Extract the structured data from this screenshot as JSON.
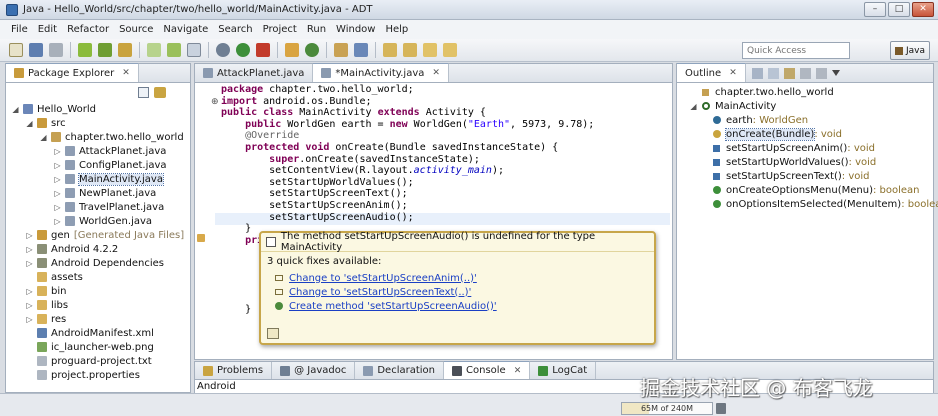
{
  "window": {
    "title": "Java - Hello_World/src/chapter/two/hello_world/MainActivity.java - ADT"
  },
  "menu": [
    "File",
    "Edit",
    "Refactor",
    "Source",
    "Navigate",
    "Search",
    "Project",
    "Run",
    "Window",
    "Help"
  ],
  "toolbar": {
    "quick_access_placeholder": "Quick Access",
    "perspective": "Java"
  },
  "package_explorer": {
    "tab": "Package Explorer",
    "tree": [
      {
        "label": "Hello_World",
        "depth": 0,
        "twisty": "open",
        "icon": "project-icon"
      },
      {
        "label": "src",
        "depth": 1,
        "twisty": "open",
        "icon": "source-folder-icon"
      },
      {
        "label": "chapter.two.hello_world",
        "depth": 2,
        "twisty": "open",
        "icon": "package-icon"
      },
      {
        "label": "AttackPlanet.java",
        "depth": 3,
        "twisty": "closed",
        "icon": "java-file-icon"
      },
      {
        "label": "ConfigPlanet.java",
        "depth": 3,
        "twisty": "closed",
        "icon": "java-file-icon"
      },
      {
        "label": "MainActivity.java",
        "depth": 3,
        "twisty": "closed",
        "icon": "java-file-icon",
        "selected": true
      },
      {
        "label": "NewPlanet.java",
        "depth": 3,
        "twisty": "closed",
        "icon": "java-file-icon"
      },
      {
        "label": "TravelPlanet.java",
        "depth": 3,
        "twisty": "closed",
        "icon": "java-file-icon"
      },
      {
        "label": "WorldGen.java",
        "depth": 3,
        "twisty": "closed",
        "icon": "java-file-icon"
      },
      {
        "label": "gen",
        "suffix": "[Generated Java Files]",
        "depth": 1,
        "twisty": "closed",
        "icon": "source-folder-icon"
      },
      {
        "label": "Android 4.2.2",
        "depth": 1,
        "twisty": "closed",
        "icon": "library-icon"
      },
      {
        "label": "Android Dependencies",
        "depth": 1,
        "twisty": "closed",
        "icon": "library-icon"
      },
      {
        "label": "assets",
        "depth": 1,
        "twisty": "none",
        "icon": "folder-icon"
      },
      {
        "label": "bin",
        "depth": 1,
        "twisty": "closed",
        "icon": "folder-icon"
      },
      {
        "label": "libs",
        "depth": 1,
        "twisty": "closed",
        "icon": "folder-icon"
      },
      {
        "label": "res",
        "depth": 1,
        "twisty": "closed",
        "icon": "folder-icon"
      },
      {
        "label": "AndroidManifest.xml",
        "depth": 1,
        "twisty": "none",
        "icon": "xml-file-icon"
      },
      {
        "label": "ic_launcher-web.png",
        "depth": 1,
        "twisty": "none",
        "icon": "image-file-icon"
      },
      {
        "label": "proguard-project.txt",
        "depth": 1,
        "twisty": "none",
        "icon": "text-file-icon"
      },
      {
        "label": "project.properties",
        "depth": 1,
        "twisty": "none",
        "icon": "text-file-icon"
      }
    ]
  },
  "editor": {
    "tabs": [
      {
        "label": "AttackPlanet.java",
        "active": false
      },
      {
        "label": "*MainActivity.java",
        "active": true
      }
    ],
    "lines": [
      "package chapter.two.hello_world;",
      "import android.os.Bundle;",
      "public class MainActivity extends Activity {",
      "    public WorldGen earth = new WorldGen(\"Earth\", 5973, 9.78);",
      "    @Override",
      "    protected void onCreate(Bundle savedInstanceState) {",
      "        super.onCreate(savedInstanceState);",
      "        setContentView(R.layout.activity_main);",
      "        setStartUpWorldValues();",
      "        setStartUpScreenText();",
      "        setStartUpScreenAnim();",
      "        setStartUpScreenAudio();",
      "    }",
      "    pri",
      "",
      "",
      "",
      "",
      "",
      "    }"
    ]
  },
  "quick_fix": {
    "message": "The method setStartUpScreenAudio() is undefined for the type MainActivity",
    "count_label": "3 quick fixes available:",
    "fixes": [
      "Change to 'setStartUpScreenAnim(..)'",
      "Change to 'setStartUpScreenText(..)'",
      "Create method 'setStartUpScreenAudio()'"
    ]
  },
  "outline": {
    "tab": "Outline",
    "items": [
      {
        "label": "chapter.two.hello_world",
        "type": "",
        "kind": "package",
        "depth": 0
      },
      {
        "label": "MainActivity",
        "type": "",
        "kind": "class",
        "depth": 0
      },
      {
        "label": "earth",
        "type": " : WorldGen",
        "kind": "field",
        "depth": 1
      },
      {
        "label": "onCreate(Bundle)",
        "type": " : void",
        "kind": "method-protected",
        "depth": 1,
        "selected": true
      },
      {
        "label": "setStartUpScreenAnim()",
        "type": " : void",
        "kind": "method-default",
        "depth": 1
      },
      {
        "label": "setStartUpWorldValues()",
        "type": " : void",
        "kind": "method-default",
        "depth": 1
      },
      {
        "label": "setStartUpScreenText()",
        "type": " : void",
        "kind": "method-default",
        "depth": 1
      },
      {
        "label": "onCreateOptionsMenu(Menu)",
        "type": " : boolean",
        "kind": "method-public",
        "depth": 1
      },
      {
        "label": "onOptionsItemSelected(MenuItem)",
        "type": " : boolean",
        "kind": "method-public",
        "depth": 1
      }
    ]
  },
  "bottom_tabs": [
    {
      "label": "Problems",
      "active": false
    },
    {
      "label": "@ Javadoc",
      "active": false
    },
    {
      "label": "Declaration",
      "active": false
    },
    {
      "label": "Console",
      "active": true
    },
    {
      "label": "LogCat",
      "active": false
    }
  ],
  "bottom_panel_text": "Android",
  "status": {
    "heap": "65M of 240M"
  },
  "watermark": "掘金技术社区 @ 布客飞龙",
  "colors": {
    "keyword": "#7f0055",
    "string": "#2a00ff",
    "annotation": "#646464",
    "field": "#0000c0",
    "link": "#1a3fc4",
    "popup_border": "#c7a64a"
  }
}
